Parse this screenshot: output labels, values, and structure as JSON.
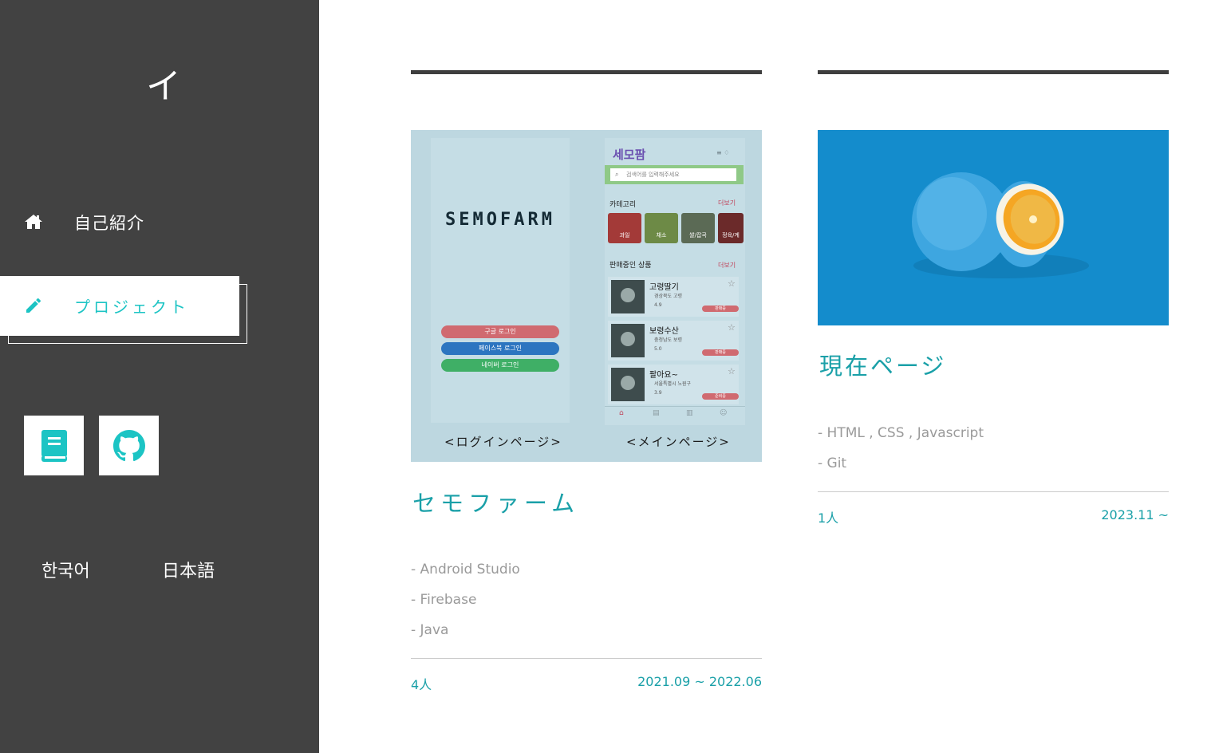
{
  "sidebar": {
    "logo": "イ",
    "nav": [
      {
        "label": "自己紹介",
        "icon": "home-icon",
        "active": false
      },
      {
        "label": "プロジェクト",
        "icon": "pencil-icon",
        "active": true
      }
    ],
    "social": [
      {
        "icon": "book-icon"
      },
      {
        "icon": "github-icon"
      }
    ],
    "languages": [
      "한국어",
      "日本語"
    ]
  },
  "projects": [
    {
      "title": "セモファーム",
      "techs": [
        "- Android Studio",
        "- Firebase",
        "- Java"
      ],
      "members": "4人",
      "period": "2021.09 ~ 2022.06",
      "thumbnail": {
        "brand": "SEMOFARM",
        "login_buttons": [
          "구글 로그인",
          "페이스북 로그인",
          "네이버 로그인"
        ],
        "app_logo": "세모팜",
        "search_placeholder": "검색어를 입력해주세요",
        "category_heading": "카테고리",
        "more": "더보기",
        "categories": [
          "과일",
          "채소",
          "쌀/잡곡",
          "정육/계"
        ],
        "products_heading": "판매중인 상품",
        "products": [
          {
            "name": "고령딸기",
            "location": "경상북도 고령",
            "rating": "4.9",
            "badge": "판매중"
          },
          {
            "name": "보령수산",
            "location": "충청남도 보령",
            "rating": "5.0",
            "badge": "판매중"
          },
          {
            "name": "팔아요~",
            "location": "서울특별시 노원구",
            "rating": "3.9",
            "badge": "준비중"
          }
        ],
        "caption_login": "<ログインページ>",
        "caption_main": "<メインページ>"
      }
    },
    {
      "title": "現在ページ",
      "techs": [
        "- HTML , CSS , Javascript",
        "- Git"
      ],
      "members": "1人",
      "period": "2023.11 ~"
    }
  ],
  "colors": {
    "sidebar_bg": "#424242",
    "accent": "#1cc4c4",
    "card_accent": "#1aa0a8"
  }
}
